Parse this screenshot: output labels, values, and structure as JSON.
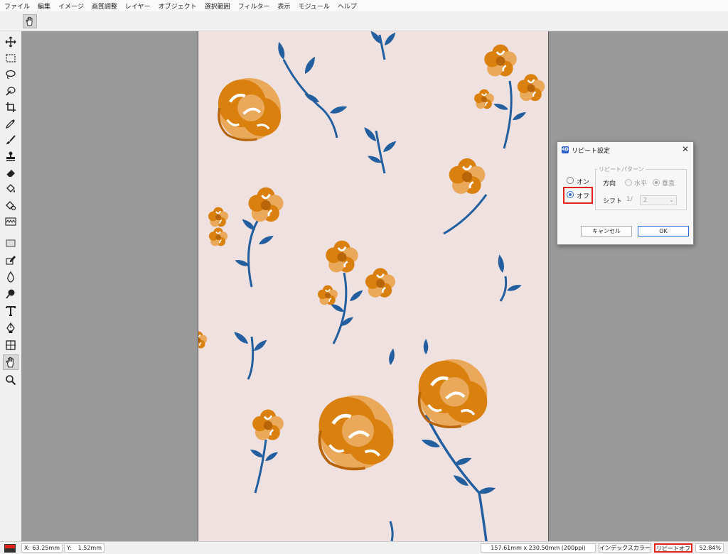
{
  "menu": [
    "ファイル",
    "編集",
    "イメージ",
    "画質調整",
    "レイヤー",
    "オブジェクト",
    "選択範囲",
    "フィルター",
    "表示",
    "モジュール",
    "ヘルプ"
  ],
  "toolbar_tools": [
    "move-tool",
    "marquee-tool",
    "lasso-tool",
    "magic-select-tool",
    "crop-tool",
    "eyedropper-tool",
    "brush-tool",
    "stamp-tool",
    "eraser-tool",
    "fill-tool",
    "replace-color-tool",
    "repeat-tool",
    "rectangle-tool",
    "pen-edit-tool",
    "blur-tool",
    "dodge-tool",
    "text-tool",
    "pen-tool",
    "transform-tool",
    "hand-tool",
    "zoom-tool"
  ],
  "active_tool": "hand-tool",
  "colors": {
    "canvas_bg": "#efe1e0",
    "flower_orange": "#d9800f",
    "flower_light": "#eaa95a",
    "leaf_blue": "#235f9e",
    "highlight_red": "#e2231a",
    "accent_blue": "#2a6fd6"
  },
  "dialog": {
    "title": "リピート設定",
    "on_label": "オン",
    "off_label": "オフ",
    "selected": "off",
    "pattern_group": "リピートパターン",
    "direction_label": "方向",
    "horizontal_label": "水平",
    "vertical_label": "垂直",
    "shift_label": "シフト",
    "shift_prefix": "1/",
    "shift_value": "2",
    "cancel_label": "キャンセル",
    "ok_label": "OK"
  },
  "status": {
    "x_label": "X:",
    "x_value": "63.25mm",
    "y_label": "Y:",
    "y_value": "1.52mm",
    "doc_size": "157.61mm x 230.50mm (200ppi)",
    "color_mode": "インデックスカラー",
    "repeat_state": "リピートオフ",
    "zoom": "52.84%"
  }
}
